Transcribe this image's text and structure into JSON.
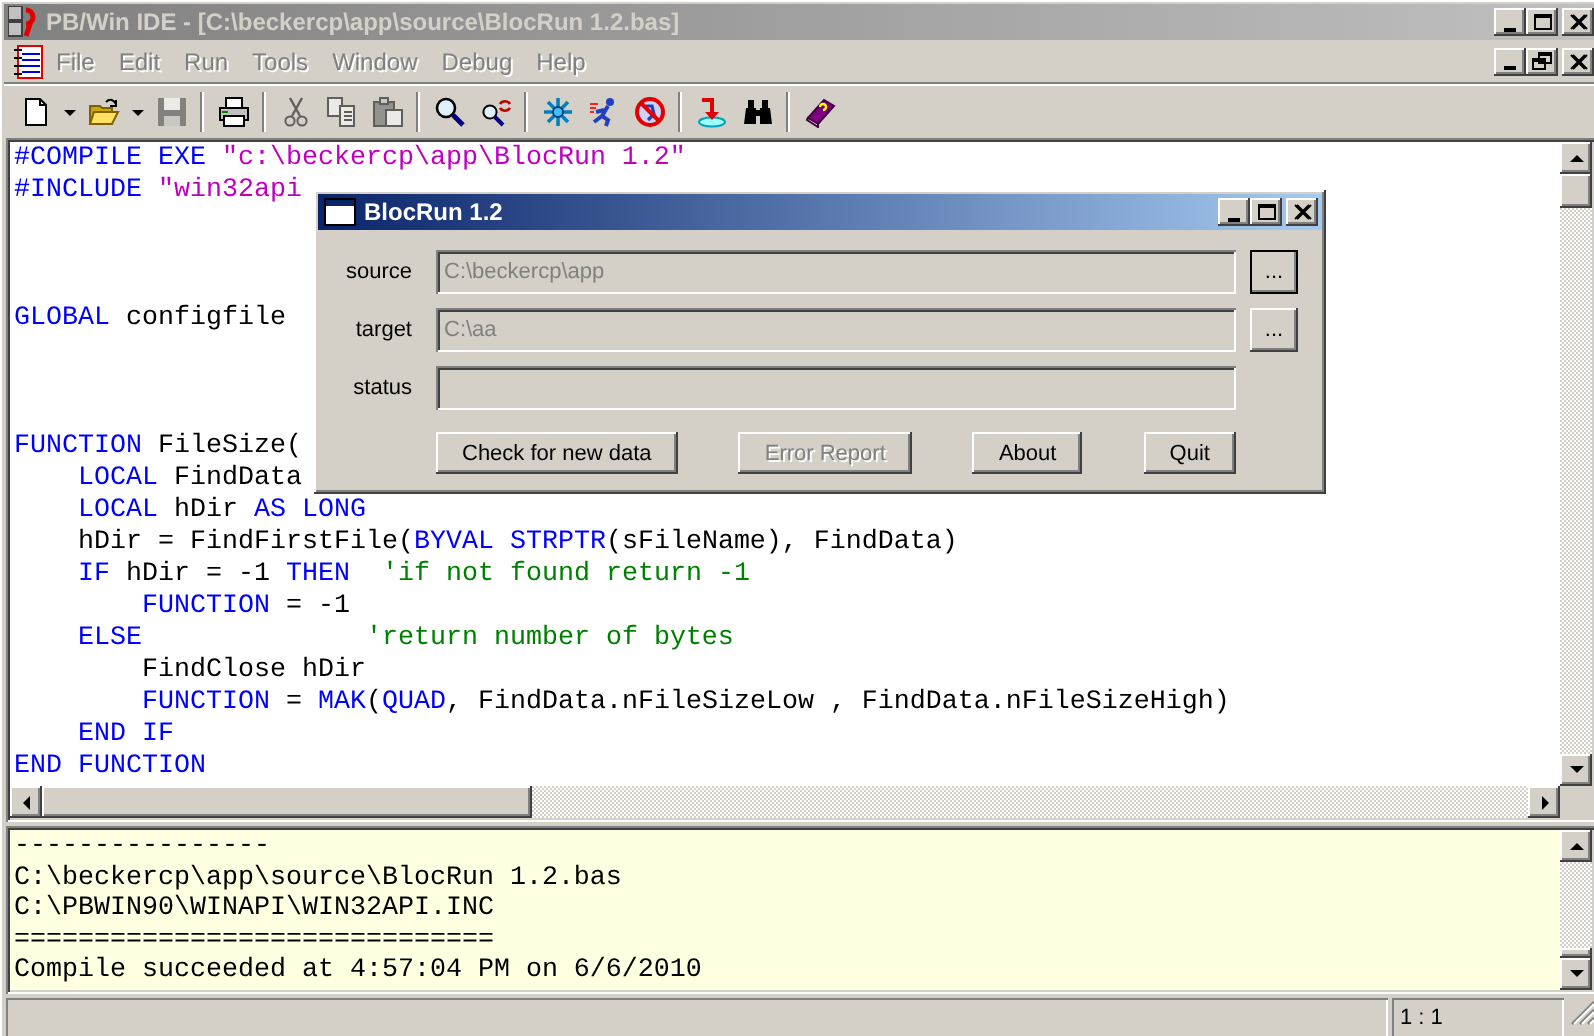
{
  "window": {
    "title": "PB/Win IDE - [C:\\beckercp\\app\\source\\BlocRun 1.2.bas]"
  },
  "menu": [
    "File",
    "Edit",
    "Run",
    "Tools",
    "Window",
    "Debug",
    "Help"
  ],
  "toolbar": [
    {
      "buttons": [
        {
          "kind": "new",
          "disabled": false
        },
        {
          "kind": "dropdown",
          "disabled": false
        },
        {
          "kind": "open",
          "disabled": false
        },
        {
          "kind": "dropdown",
          "disabled": false
        },
        {
          "kind": "save",
          "disabled": true
        }
      ]
    },
    {
      "buttons": [
        {
          "kind": "print",
          "disabled": false
        }
      ]
    },
    {
      "buttons": [
        {
          "kind": "cut",
          "disabled": true
        },
        {
          "kind": "copy",
          "disabled": true
        },
        {
          "kind": "paste",
          "disabled": true
        }
      ]
    },
    {
      "buttons": [
        {
          "kind": "find",
          "disabled": false
        },
        {
          "kind": "replace",
          "disabled": false
        }
      ]
    },
    {
      "buttons": [
        {
          "kind": "compile",
          "disabled": false
        },
        {
          "kind": "run",
          "disabled": false
        },
        {
          "kind": "debug",
          "disabled": false
        }
      ]
    },
    {
      "buttons": [
        {
          "kind": "step",
          "disabled": false
        },
        {
          "kind": "binoculars",
          "disabled": false
        }
      ]
    },
    {
      "buttons": [
        {
          "kind": "help",
          "disabled": false
        }
      ]
    }
  ],
  "editor": {
    "blocks": [
      {
        "lines": [
          {
            "segments": [
              {
                "kind": "keyword",
                "text": "#COMPILE EXE"
              },
              {
                "kind": "string",
                "text": " \"c:\\beckercp\\app\\BlocRun 1.2\""
              }
            ]
          },
          {
            "segments": [
              {
                "kind": "keyword",
                "text": "#INCLUDE"
              },
              {
                "kind": "string",
                "text": " \"win32api"
              }
            ]
          }
        ]
      },
      {
        "lines": [
          {
            "segments": [
              {
                "kind": "keyword",
                "text": "GLOBAL"
              },
              {
                "kind": "plain",
                "text": " configfile"
              }
            ]
          }
        ]
      },
      {
        "lines": [
          {
            "segments": [
              {
                "kind": "keyword",
                "text": "FUNCTION"
              },
              {
                "kind": "plain",
                "text": " FileSize("
              }
            ]
          },
          {
            "segments": [
              {
                "kind": "keyword",
                "text": "    LOCAL"
              },
              {
                "kind": "plain",
                "text": " FindData"
              }
            ]
          },
          {
            "segments": [
              {
                "kind": "keyword",
                "text": "    LOCAL"
              },
              {
                "kind": "plain",
                "text": " hDir "
              },
              {
                "kind": "keyword",
                "text": "AS LONG"
              }
            ]
          },
          {
            "segments": [
              {
                "kind": "plain",
                "text": "    hDir = FindFirstFile("
              },
              {
                "kind": "keyword",
                "text": "BYVAL STRPTR"
              },
              {
                "kind": "plain",
                "text": "(sFileName), FindData)"
              }
            ]
          },
          {
            "segments": [
              {
                "kind": "keyword",
                "text": "    IF"
              },
              {
                "kind": "plain",
                "text": " hDir = -1 "
              },
              {
                "kind": "keyword",
                "text": "THEN"
              },
              {
                "kind": "comment",
                "text": "  'if not found return -1"
              }
            ]
          },
          {
            "segments": [
              {
                "kind": "keyword",
                "text": "        FUNCTION"
              },
              {
                "kind": "plain",
                "text": " = -1"
              }
            ]
          },
          {
            "segments": [
              {
                "kind": "keyword",
                "text": "    ELSE"
              },
              {
                "kind": "comment",
                "text": "              'return number of bytes"
              }
            ]
          },
          {
            "segments": [
              {
                "kind": "plain",
                "text": "        FindClose hDir"
              }
            ]
          },
          {
            "segments": [
              {
                "kind": "keyword",
                "text": "        FUNCTION"
              },
              {
                "kind": "plain",
                "text": " = "
              },
              {
                "kind": "keyword",
                "text": "MAK"
              },
              {
                "kind": "plain",
                "text": "("
              },
              {
                "kind": "keyword",
                "text": "QUAD"
              },
              {
                "kind": "plain",
                "text": ", FindData.nFileSizeLow , FindData.nFileSizeHigh)"
              }
            ]
          },
          {
            "segments": [
              {
                "kind": "keyword",
                "text": "    END IF"
              }
            ]
          },
          {
            "segments": [
              {
                "kind": "keyword",
                "text": "END FUNCTION"
              }
            ]
          }
        ]
      }
    ]
  },
  "output": {
    "lines": [
      "----------------",
      "C:\\beckercp\\app\\source\\BlocRun 1.2.bas",
      "C:\\PBWIN90\\WINAPI\\WIN32API.INC",
      "==============================",
      "Compile succeeded at 4:57:04 PM on 6/6/2010"
    ]
  },
  "status_bar": {
    "position": "1 : 1"
  },
  "dialog": {
    "title": "BlocRun 1.2",
    "fields": [
      {
        "label": "source",
        "value": "C:\\beckercp\\app",
        "disabled": true,
        "browse": "..."
      },
      {
        "label": "target",
        "value": "C:\\aa",
        "disabled": true,
        "browse": "..."
      },
      {
        "label": "status",
        "disabled": true
      }
    ],
    "buttons": [
      {
        "label": "Check for new data",
        "disabled": false
      },
      {
        "label": "Error Report",
        "disabled": true
      },
      {
        "label": "About",
        "disabled": false
      },
      {
        "label": "Quit",
        "disabled": false
      }
    ]
  }
}
